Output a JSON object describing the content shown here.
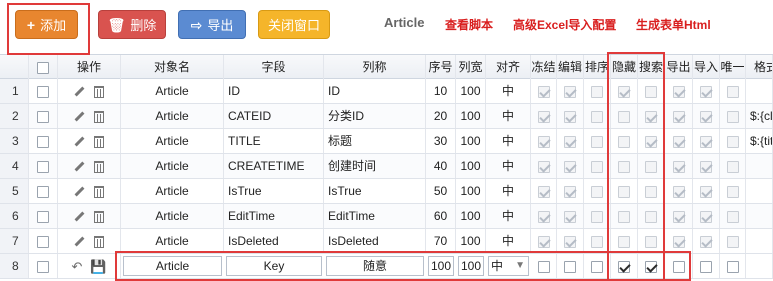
{
  "toolbar": {
    "add": {
      "glyph": "+",
      "label": "添加"
    },
    "delete": {
      "glyph": "🗑",
      "label": "删除"
    },
    "export": {
      "glyph": "⇨",
      "label": "导出"
    },
    "close": {
      "label": "关闭窗口"
    },
    "object_name": "Article",
    "view_script": "查看脚本",
    "excel_config": "高级Excel导入配置",
    "gen_form": "生成表单Html"
  },
  "headers": [
    "",
    "操作",
    "对象名",
    "字段",
    "列称",
    "序号",
    "列宽",
    "对齐",
    "冻结",
    "编辑",
    "排序",
    "隐藏",
    "搜索",
    "导出",
    "导入",
    "唯一",
    "格式"
  ],
  "rows": [
    {
      "num": "1",
      "object": "Article",
      "field": "ID",
      "colname": "ID",
      "seq": "10",
      "width": "100",
      "align": "中",
      "format": ""
    },
    {
      "num": "2",
      "object": "Article",
      "field": "CATEID",
      "colname": "分类ID",
      "seq": "20",
      "width": "100",
      "align": "中",
      "format": "$:{cl"
    },
    {
      "num": "3",
      "object": "Article",
      "field": "TITLE",
      "colname": "标题",
      "seq": "30",
      "width": "100",
      "align": "中",
      "format": "$:{tit"
    },
    {
      "num": "4",
      "object": "Article",
      "field": "CREATETIME",
      "colname": "创建时间",
      "seq": "40",
      "width": "100",
      "align": "中",
      "format": ""
    },
    {
      "num": "5",
      "object": "Article",
      "field": "IsTrue",
      "colname": "IsTrue",
      "seq": "50",
      "width": "100",
      "align": "中",
      "format": ""
    },
    {
      "num": "6",
      "object": "Article",
      "field": "EditTime",
      "colname": "EditTime",
      "seq": "60",
      "width": "100",
      "align": "中",
      "format": ""
    },
    {
      "num": "7",
      "object": "Article",
      "field": "IsDeleted",
      "colname": "IsDeleted",
      "seq": "70",
      "width": "100",
      "align": "中",
      "format": ""
    }
  ],
  "edit_row": {
    "num": "8",
    "object": "Article",
    "field": "Key",
    "colname": "随意",
    "seq": "100",
    "width": "100",
    "align": "中"
  }
}
